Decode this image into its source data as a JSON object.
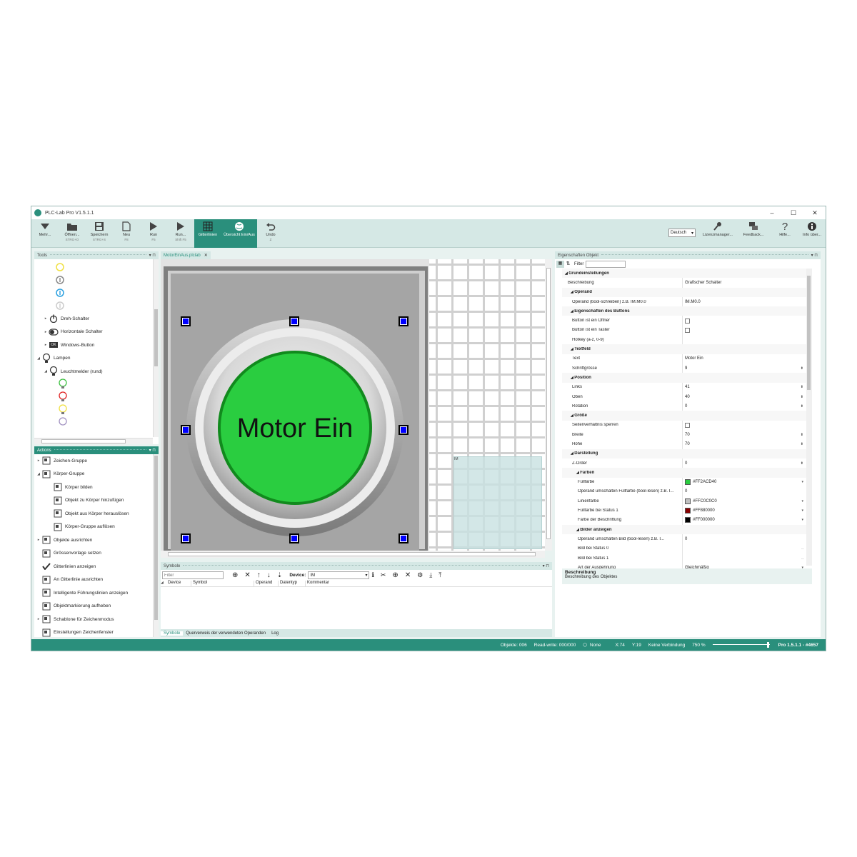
{
  "window": {
    "title": "PLC-Lab Pro V1.5.1.1",
    "minimize": "–",
    "maximize": "☐",
    "close": "✕"
  },
  "ribbon": {
    "buttons": [
      {
        "label": "Mehr...",
        "sub": ""
      },
      {
        "label": "Öffnen...",
        "sub": "STRG+O"
      },
      {
        "label": "Speichern",
        "sub": "STRG+S"
      },
      {
        "label": "Neu",
        "sub": "F8"
      },
      {
        "label": "Run",
        "sub": "F5"
      },
      {
        "label": "Run...",
        "sub": "Shift F5"
      },
      {
        "label": "Gitterlinien",
        "sub": ""
      },
      {
        "label": "Übersicht Ein/Aus",
        "sub": ""
      },
      {
        "label": "Undo",
        "sub": "Z"
      }
    ],
    "language": "Deutsch",
    "right": [
      {
        "label": "Lizenzmanager..."
      },
      {
        "label": "Feedback..."
      },
      {
        "label": "Hilfe..."
      },
      {
        "label": "Info über..."
      }
    ]
  },
  "tools": {
    "title": "Tools",
    "items": [
      {
        "label": "Dreh-Schalter",
        "arrow": "▸"
      },
      {
        "label": "Horizontale Schalter",
        "arrow": "▸"
      },
      {
        "label": "Windows-Button",
        "arrow": "▸",
        "badge": "OK"
      },
      {
        "label": "Lampen",
        "arrow": "◢"
      },
      {
        "label": "Leuchtmelder (rund)",
        "arrow": "◢"
      }
    ]
  },
  "actions": {
    "title": "Actions",
    "items": [
      {
        "label": "Zeichen-Gruppe",
        "arrow": "▸"
      },
      {
        "label": "Körper-Gruppe",
        "arrow": "◢"
      },
      {
        "label": "Körper bilden",
        "arrow": ""
      },
      {
        "label": "Objekt zu Körper hinzufügen",
        "arrow": ""
      },
      {
        "label": "Objekt aus Körper herauslösen",
        "arrow": ""
      },
      {
        "label": "Körper-Gruppe auflösen",
        "arrow": ""
      },
      {
        "label": "Objekte ausrichten",
        "arrow": "▸"
      },
      {
        "label": "Grössenvorlage setzen",
        "arrow": ""
      },
      {
        "label": "Gitterlinien anzeigen",
        "arrow": ""
      },
      {
        "label": "An Gitterlinie ausrichten",
        "arrow": ""
      },
      {
        "label": "Intelligente Führungslinien anzeigen",
        "arrow": ""
      },
      {
        "label": "Objektmarkierung aufheben",
        "arrow": ""
      },
      {
        "label": "Schablone für Zeichenmodus",
        "arrow": "▸"
      },
      {
        "label": "Einstellungen Zeichenfenster",
        "arrow": ""
      }
    ]
  },
  "editor": {
    "tab": "MotorEinAus.plclab",
    "tab_close": "✕",
    "button_text": "Motor Ein",
    "overview_label": "IM"
  },
  "symbols": {
    "title": "Symbole",
    "filter_placeholder": "Filter",
    "device_label": "Device:",
    "device_value": "IM",
    "columns": [
      "Device",
      "Symbol",
      "Operand",
      "Datentyp",
      "Kommentar"
    ],
    "tabs": [
      "Symbole",
      "Querverweis der verwendeten Operanden",
      "Log"
    ]
  },
  "properties": {
    "title": "Eigenschaften Objekt",
    "filter_label": "Filter",
    "rows": [
      {
        "t": "cat",
        "k": "Grundeinstellungen",
        "v": ""
      },
      {
        "t": "row",
        "k": "Beschreibung",
        "v": "Grafischer Schalter"
      },
      {
        "t": "cat2",
        "k": "Operand",
        "v": ""
      },
      {
        "t": "sub",
        "k": "Operand (bool-schreiben) z.B. IM.M0.0",
        "v": "IM.M0.0"
      },
      {
        "t": "cat2",
        "k": "Eigenschaften des Buttons",
        "v": ""
      },
      {
        "t": "sub",
        "k": "Button ist ein Öffner",
        "v": "",
        "chk": true
      },
      {
        "t": "sub",
        "k": "Button ist ein Taster",
        "v": "",
        "chk": true
      },
      {
        "t": "sub",
        "k": "Hotkey (a-z, 0-9)",
        "v": ""
      },
      {
        "t": "cat2",
        "k": "Textfeld",
        "v": ""
      },
      {
        "t": "sub",
        "k": "Text",
        "v": "Motor Ein"
      },
      {
        "t": "sub",
        "k": "Schriftgrösse",
        "v": "9",
        "spin": true
      },
      {
        "t": "cat2",
        "k": "Position",
        "v": ""
      },
      {
        "t": "sub",
        "k": "Links",
        "v": "41",
        "spin": true
      },
      {
        "t": "sub",
        "k": "Oben",
        "v": "40",
        "spin": true
      },
      {
        "t": "sub",
        "k": "Rotation",
        "v": "0",
        "spin": true
      },
      {
        "t": "cat2",
        "k": "Größe",
        "v": ""
      },
      {
        "t": "sub",
        "k": "Seitenverhältnis sperren",
        "v": "",
        "chk": true
      },
      {
        "t": "sub",
        "k": "Breite",
        "v": "70",
        "spin": true
      },
      {
        "t": "sub",
        "k": "Höhe",
        "v": "70",
        "spin": true
      },
      {
        "t": "cat2",
        "k": "Darstellung",
        "v": ""
      },
      {
        "t": "sub",
        "k": "Z-Order",
        "v": "0",
        "spin": true
      },
      {
        "t": "cat3",
        "k": "Farben",
        "v": ""
      },
      {
        "t": "subsub",
        "k": "Füllfarbe",
        "v": "#FF2ACD40",
        "color": "#2ACD40",
        "dd": true
      },
      {
        "t": "subsub",
        "k": "Operand umschalten Füllfarbe (bool-lesen) z.B. I...",
        "v": "0"
      },
      {
        "t": "subsub",
        "k": "Linienfarbe",
        "v": "#FFC0C0C0",
        "color": "#C0C0C0",
        "dd": true
      },
      {
        "t": "subsub",
        "k": "Füllfarbe bei Status 1",
        "v": "#FF880000",
        "color": "#880000",
        "dd": true
      },
      {
        "t": "subsub",
        "k": "Farbe der Beschriftung",
        "v": "#FF000000",
        "color": "#000000",
        "dd": true
      },
      {
        "t": "cat3",
        "k": "Bilder anzeigen",
        "v": ""
      },
      {
        "t": "subsub",
        "k": "Operand umschalten Bild (bool-lesen) z.B. I...",
        "v": "0"
      },
      {
        "t": "subsub",
        "k": "Bild bei Status 0",
        "v": "",
        "dots": true
      },
      {
        "t": "subsub",
        "k": "Bild bei Status 1",
        "v": "",
        "dots": true
      },
      {
        "t": "subsub",
        "k": "Art der Ausdehnung",
        "v": "Gleichmäßig",
        "dd": true
      }
    ],
    "desc_title": "Beschreibung",
    "desc_text": "Beschreibung des Objektes"
  },
  "statusbar": {
    "objects": "Objekte: 006",
    "readwrite": "Read-write: 000/000",
    "mode": "None",
    "x": "X:74",
    "y": "Y:19",
    "connection": "Keine Verbindung",
    "zoom": "750 %",
    "version": "Pro 1.5.1.1 - #4657"
  },
  "colors": {
    "accent": "#2a8f7c",
    "button_green": "#2ACD40",
    "handle": "#0000ff"
  }
}
